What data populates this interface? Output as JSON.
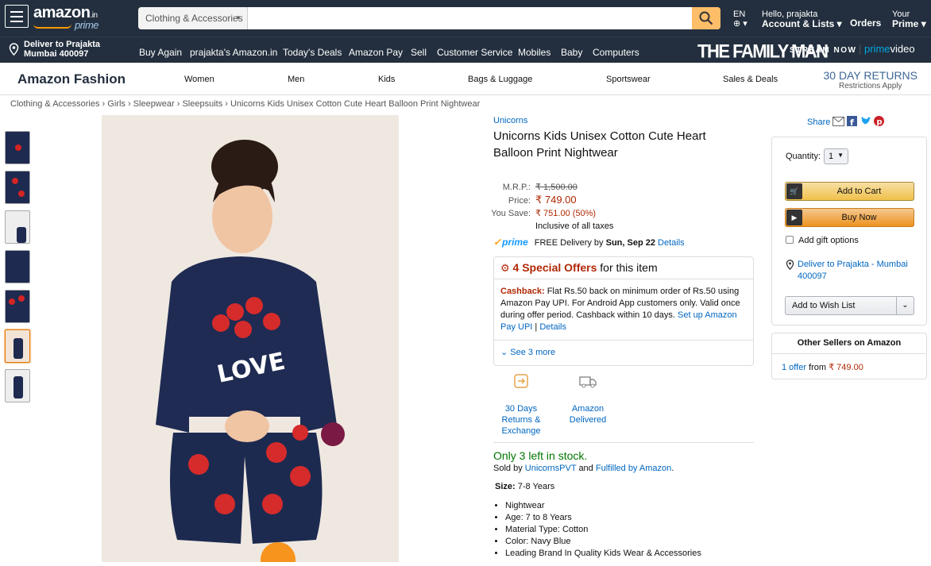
{
  "header": {
    "logo_text": "amazon",
    "logo_suffix": ".in",
    "logo_prime": "prime",
    "search_category": "Clothing & Accessories",
    "search_placeholder": "",
    "lang": "EN",
    "account_greeting": "Hello, prajakta",
    "account_label": "Account & Lists",
    "orders": "Orders",
    "your": "Your",
    "prime": "Prime"
  },
  "subnav": {
    "deliver_line1": "Deliver to Prajakta",
    "deliver_line2": "Mumbai 400097",
    "links": [
      "Buy Again",
      "prajakta's Amazon.in",
      "Today's Deals",
      "Amazon Pay",
      "Sell",
      "Customer Service",
      "Mobiles",
      "Baby",
      "Computers"
    ],
    "promo_title": "THE FAMILY MAN",
    "promo_stream": "STREAM NOW",
    "promo_pv_a": "prime",
    "promo_pv_b": "video"
  },
  "fashion": {
    "title": "Amazon Fashion",
    "nav": [
      "Women",
      "Men",
      "Kids",
      "Bags & Luggage",
      "Sportswear",
      "Sales & Deals"
    ],
    "returns_title": "30 DAY RETURNS",
    "returns_sub": "Restrictions Apply"
  },
  "breadcrumb": [
    "Clothing & Accessories",
    "Girls",
    "Sleepwear",
    "Sleepsuits",
    "Unicorns Kids Unisex Cotton Cute Heart Balloon Print Nightwear"
  ],
  "product": {
    "brand": "Unicorns",
    "title": "Unicorns Kids Unisex Cotton Cute Heart Balloon Print Nightwear",
    "mrp_label": "M.R.P.:",
    "mrp": "₹ 1,500.00",
    "price_label": "Price:",
    "price": "₹ 749.00",
    "save_label": "You Save:",
    "save": "₹ 751.00 (50%)",
    "taxes": "Inclusive of all taxes",
    "prime_badge": "prime",
    "delivery_text": "FREE Delivery by",
    "delivery_date": "Sun, Sep 22",
    "delivery_details": "Details",
    "offers_count": "4 Special Offers",
    "offers_suffix": "for this item",
    "cashback_label": "Cashback:",
    "cashback_text": "Flat Rs.50 back on minimum order of Rs.50 using Amazon Pay UPI. For Android App customers only. Valid once during offer period. Cashback within 10 days.",
    "cashback_link": "Set up Amazon Pay UPI",
    "cashback_details": "Details",
    "see_more": "See 3 more",
    "badge1": "30 Days Returns & Exchange",
    "badge2": "Amazon Delivered",
    "stock": "Only 3 left in stock.",
    "sold_by_label": "Sold by",
    "seller": "UnicornsPVT",
    "and": "and",
    "fulfilled": "Fulfilled by Amazon",
    "size_label": "Size:",
    "size": "7-8 Years",
    "bullets": [
      "Nightwear",
      "Age: 7 to 8 Years",
      "Material Type: Cotton",
      "Color: Navy Blue",
      "Leading Brand In Quality Kids Wear & Accessories"
    ]
  },
  "buybox": {
    "share": "Share",
    "quantity_label": "Quantity:",
    "quantity": "1",
    "add_to_cart": "Add to Cart",
    "buy_now": "Buy Now",
    "gift": "Add gift options",
    "deliver": "Deliver to Prajakta - Mumbai 400097",
    "wishlist": "Add to Wish List",
    "other_sellers_title": "Other Sellers on Amazon",
    "other_offer": "1 offer",
    "other_from": "from",
    "other_price": "₹ 749.00"
  },
  "colors": {
    "header": "#232f3e",
    "accent": "#febd69",
    "price": "#b12704",
    "link": "#0066c0",
    "stock": "#007600"
  }
}
